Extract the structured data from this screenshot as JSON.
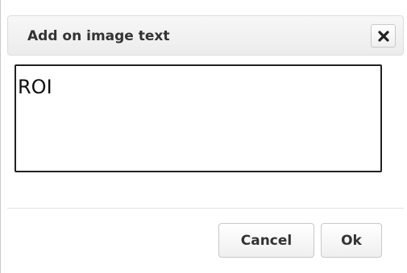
{
  "dialog": {
    "title": "Add on image text",
    "close_icon": "close-icon",
    "input": {
      "value": "ROI"
    },
    "buttons": {
      "cancel_label": "Cancel",
      "ok_label": "Ok"
    }
  }
}
